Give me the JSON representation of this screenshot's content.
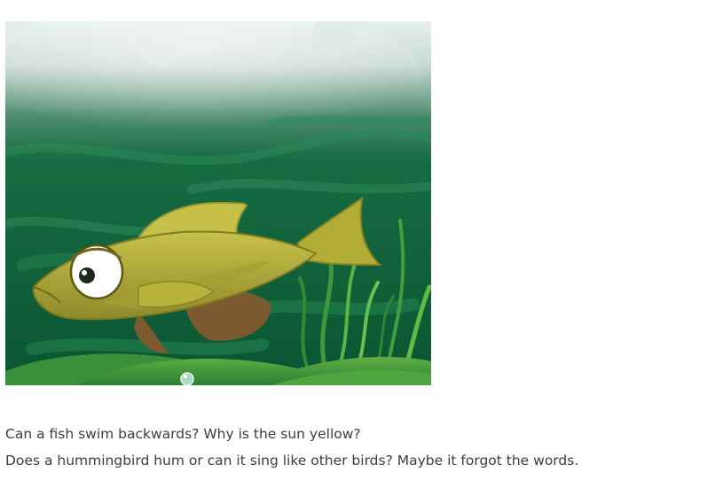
{
  "article": {
    "image": {
      "description": "fish-underwater-illustration"
    },
    "caption": {
      "line1": "Can a fish swim backwards? Why is the sun yellow?",
      "line2": "Does a hummingbird hum or can it sing like other birds? Maybe it forgot the words."
    }
  },
  "colors": {
    "water_dark": "#0e5a35",
    "water_mid": "#1d7a47",
    "fish_body": "#b3ad3a",
    "fish_fin": "#c2bf4a",
    "seaweed": "#4caa3c",
    "text": "#3d3d3d"
  }
}
